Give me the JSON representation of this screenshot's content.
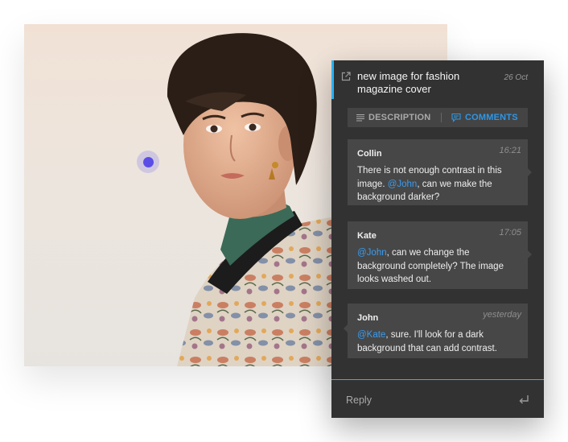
{
  "colors": {
    "accent_blue": "#2ab0f0",
    "mention_blue": "#3a9cf0",
    "pin_purple": "#5a4de6",
    "panel_bg": "#323232",
    "comment_bg": "#474747"
  },
  "image": {
    "description_icon": "portrait-photo"
  },
  "annotation": {
    "icon": "annotation-pin-icon"
  },
  "panel": {
    "title": "new image for fashion magazine cover",
    "date": "26 Oct",
    "open_icon": "external-link-icon"
  },
  "tabs": [
    {
      "label": "DESCRIPTION",
      "icon": "lines-icon",
      "active": false
    },
    {
      "label": "COMMENTS",
      "icon": "chat-icon",
      "active": true
    }
  ],
  "comments": [
    {
      "author": "Collin",
      "time": "16:21",
      "parts": [
        {
          "t": "There is not enough contrast in this image. "
        },
        {
          "t": "@John",
          "m": true
        },
        {
          "t": ", can we make the background darker?"
        }
      ]
    },
    {
      "author": "Kate",
      "time": "17:05",
      "parts": [
        {
          "t": "@John",
          "m": true
        },
        {
          "t": ", can we change the background completely? The image looks washed out."
        }
      ]
    },
    {
      "author": "John",
      "time": "yesterday",
      "parts": [
        {
          "t": "@Kate",
          "m": true
        },
        {
          "t": ", sure. I'll look for a dark background that can add contrast."
        }
      ]
    }
  ],
  "reply": {
    "placeholder": "Reply",
    "value": "",
    "send_icon": "enter-return-icon"
  }
}
